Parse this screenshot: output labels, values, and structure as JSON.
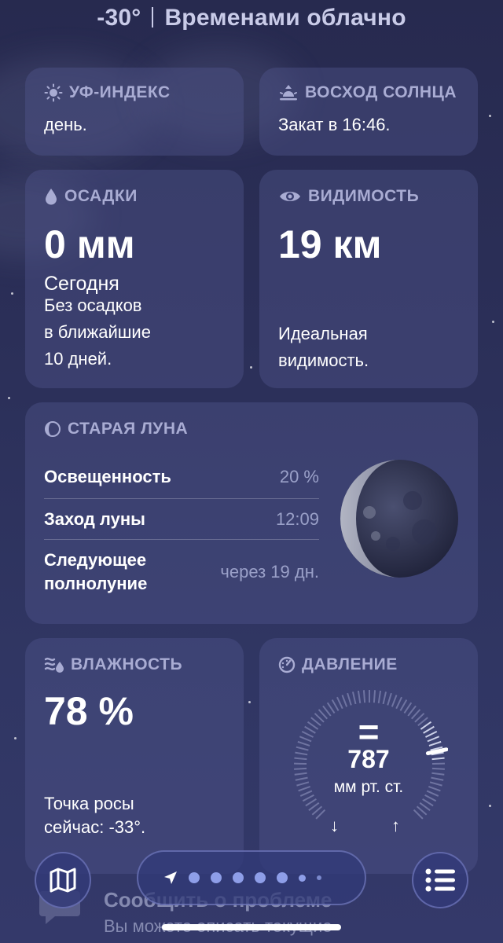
{
  "header": {
    "temperature": "-30°",
    "condition": "Временами облачно"
  },
  "uv": {
    "title": "УФ-ИНДЕКС",
    "text": "день.",
    "icon": "sun-icon"
  },
  "sunrise": {
    "title": "ВОСХОД СОЛНЦА",
    "text": "Закат в 16:46.",
    "icon": "sunrise-icon"
  },
  "precip": {
    "title": "ОСАДКИ",
    "value": "0 мм",
    "period": "Сегодня",
    "line1": "Без осадков",
    "line2": "в ближайшие",
    "line3": "10 дней.",
    "icon": "raindrop-icon"
  },
  "visibility": {
    "title": "ВИДИМОСТЬ",
    "value": "19 км",
    "line1": "Идеальная",
    "line2": "видимость.",
    "icon": "eye-icon"
  },
  "moon": {
    "title": "СТАРАЯ ЛУНА",
    "rows": [
      {
        "label": "Освещенность",
        "value": "20 %"
      },
      {
        "label": "Заход луны",
        "value": "12:09"
      },
      {
        "label_line1": "Следующее",
        "label_line2": "полнолуние",
        "value": "через 19 дн."
      }
    ],
    "icon": "moon-phase-icon",
    "illumination_fraction": 0.2
  },
  "humidity": {
    "title": "ВЛАЖНОСТЬ",
    "value": "78 %",
    "line1": "Точка росы",
    "line2": "сейчас: -33°.",
    "icon": "humidity-icon"
  },
  "pressure": {
    "title": "ДАВЛЕНИЕ",
    "trend_symbol": "=",
    "value": "787",
    "unit": "мм рт. ст.",
    "low_symbol": "↓",
    "high_symbol": "↑",
    "icon": "gauge-icon"
  },
  "nav": {
    "map_icon": "map-icon",
    "location_icon": "location-arrow-icon",
    "list_icon": "list-icon",
    "page_dots": 7
  },
  "banner": {
    "title": "Сообщить о проблеме",
    "text": "Вы можете описать текущие"
  },
  "colors": {
    "accent": "#8e9ee8",
    "card": "#4e5590",
    "title_text": "#a9acd3"
  }
}
